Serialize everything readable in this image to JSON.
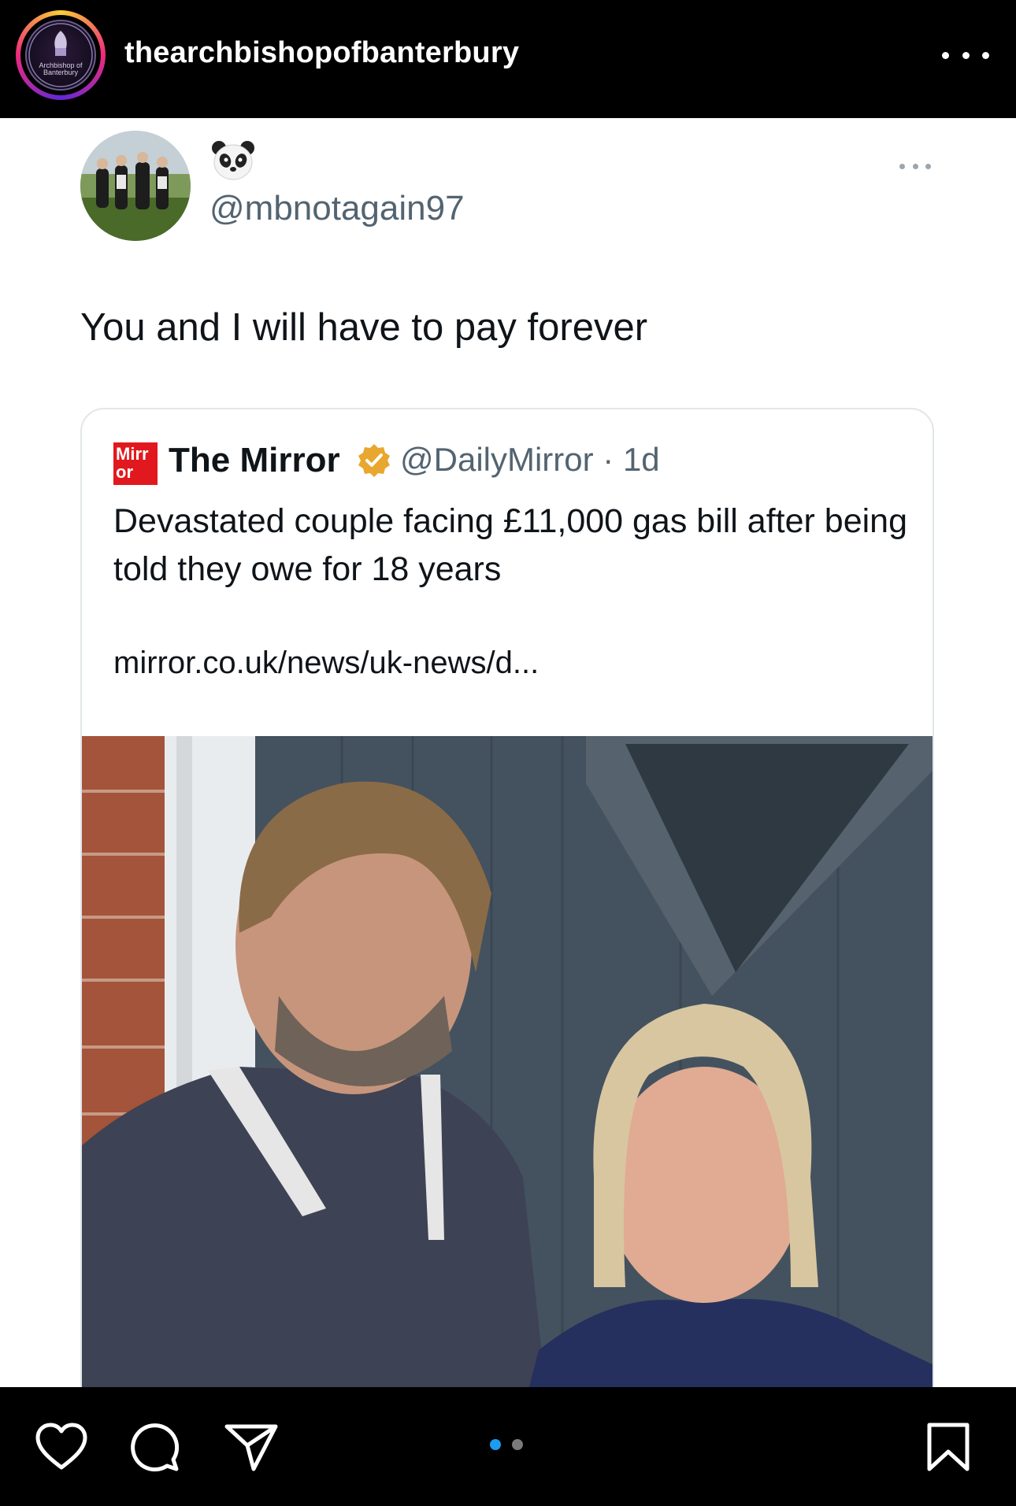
{
  "instagram": {
    "username": "thearchbishopofbanterbury",
    "avatar_text": "Archbishop of Banterbury",
    "more_icon": "more-horizontal-icon",
    "carousel": {
      "current": 1,
      "total": 2,
      "active_color": "#1d9bf0"
    },
    "actions": [
      "heart-icon",
      "comment-icon",
      "share-icon",
      "bookmark-icon"
    ]
  },
  "tweet": {
    "emoji": "panda-face-icon",
    "handle": "@mbnotagain97",
    "text": "You and I will have to pay forever",
    "quoted": {
      "logo_text": [
        "Mirr",
        "or"
      ],
      "name": "The Mirror",
      "handle_time": "@DailyMirror · 1d",
      "headline": "Devastated couple facing £11,000 gas bill after being told they owe for 18 years",
      "link": "mirror.co.uk/news/uk-news/d..."
    }
  },
  "colors": {
    "mirror_red": "#e1191e",
    "verified_gold": "#e8a72e",
    "secondary_text": "#536471"
  }
}
